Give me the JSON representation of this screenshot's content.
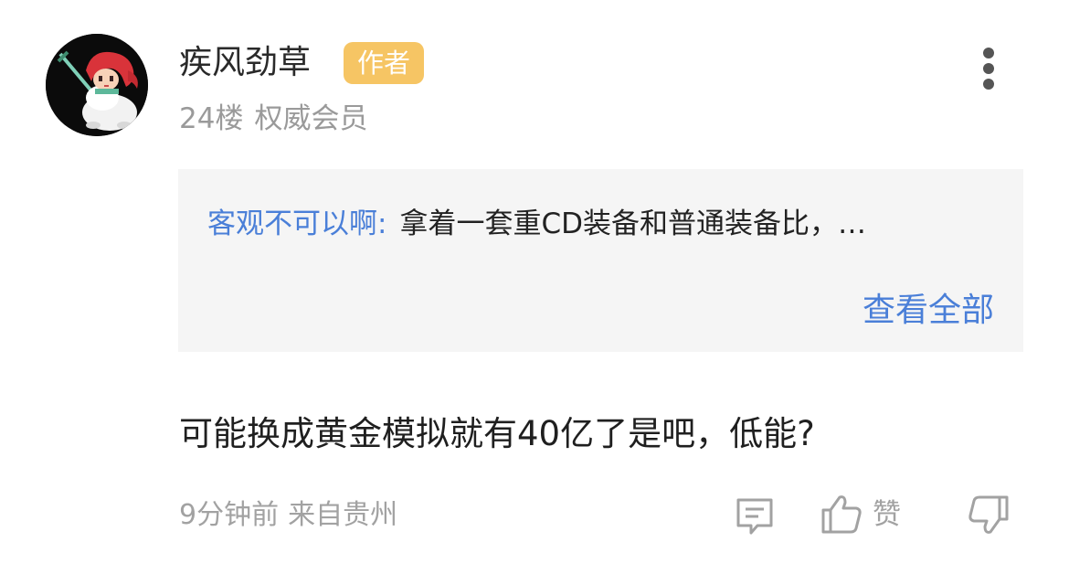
{
  "post": {
    "user": {
      "name": "疾风劲草",
      "badge": "作者",
      "floor": "24楼",
      "level": "权威会员",
      "avatar_icon": "pixel-character-avatar"
    },
    "more_icon": "more-vertical-icon",
    "quote": {
      "author": "客观不可以啊:",
      "text": "拿着一套重CD装备和普通装备比，…",
      "view_all": "查看全部"
    },
    "content": "可能换成黄金模拟就有40亿了是吧，低能?",
    "footer": {
      "time": "9分钟前",
      "location": "来自贵州",
      "like_label": "赞",
      "comment_icon": "comment-icon",
      "like_icon": "thumbs-up-icon",
      "dislike_icon": "thumbs-down-icon"
    },
    "colors": {
      "badge": "#f6c564",
      "link": "#4a7fd8",
      "muted": "#9a9a9a",
      "quote_bg": "#f5f5f5"
    }
  }
}
